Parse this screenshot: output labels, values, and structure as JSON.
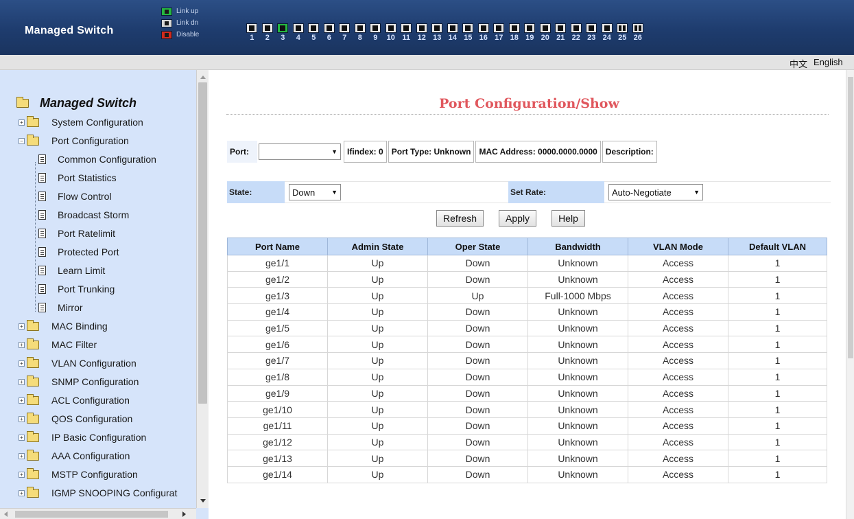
{
  "header": {
    "brand": "Managed Switch",
    "legend": {
      "link_up": "Link up",
      "link_dn": "Link dn",
      "disable": "Disable"
    },
    "ports": [
      {
        "num": "1",
        "state": "down"
      },
      {
        "num": "2",
        "state": "down"
      },
      {
        "num": "3",
        "state": "up"
      },
      {
        "num": "4",
        "state": "down"
      },
      {
        "num": "5",
        "state": "down"
      },
      {
        "num": "6",
        "state": "down"
      },
      {
        "num": "7",
        "state": "down"
      },
      {
        "num": "8",
        "state": "down"
      },
      {
        "num": "9",
        "state": "down"
      },
      {
        "num": "10",
        "state": "down"
      },
      {
        "num": "11",
        "state": "down"
      },
      {
        "num": "12",
        "state": "down"
      },
      {
        "num": "13",
        "state": "down"
      },
      {
        "num": "14",
        "state": "down"
      },
      {
        "num": "15",
        "state": "down"
      },
      {
        "num": "16",
        "state": "down"
      },
      {
        "num": "17",
        "state": "down"
      },
      {
        "num": "18",
        "state": "down"
      },
      {
        "num": "19",
        "state": "down"
      },
      {
        "num": "20",
        "state": "down"
      },
      {
        "num": "21",
        "state": "down"
      },
      {
        "num": "22",
        "state": "down"
      },
      {
        "num": "23",
        "state": "down"
      },
      {
        "num": "24",
        "state": "down"
      },
      {
        "num": "25",
        "state": "sfp"
      },
      {
        "num": "26",
        "state": "sfp"
      }
    ]
  },
  "langbar": {
    "zh": "中文",
    "en": "English"
  },
  "sidebar": {
    "root": "Managed Switch",
    "items": [
      {
        "label": "System Configuration",
        "type": "folder",
        "expander": "+"
      },
      {
        "label": "Port Configuration",
        "type": "folder-open",
        "expander": "-"
      },
      {
        "label": "Common Configuration",
        "type": "doc"
      },
      {
        "label": "Port Statistics",
        "type": "doc"
      },
      {
        "label": "Flow Control",
        "type": "doc"
      },
      {
        "label": "Broadcast Storm",
        "type": "doc"
      },
      {
        "label": "Port Ratelimit",
        "type": "doc"
      },
      {
        "label": "Protected Port",
        "type": "doc"
      },
      {
        "label": "Learn Limit",
        "type": "doc"
      },
      {
        "label": "Port Trunking",
        "type": "doc"
      },
      {
        "label": "Mirror",
        "type": "doc"
      },
      {
        "label": "MAC Binding",
        "type": "folder",
        "expander": "+"
      },
      {
        "label": "MAC Filter",
        "type": "folder",
        "expander": "+"
      },
      {
        "label": "VLAN Configuration",
        "type": "folder",
        "expander": "+"
      },
      {
        "label": "SNMP Configuration",
        "type": "folder",
        "expander": "+"
      },
      {
        "label": "ACL Configuration",
        "type": "folder",
        "expander": "+"
      },
      {
        "label": "QOS Configuration",
        "type": "folder",
        "expander": "+"
      },
      {
        "label": "IP Basic Configuration",
        "type": "folder",
        "expander": "+"
      },
      {
        "label": "AAA Configuration",
        "type": "folder",
        "expander": "+"
      },
      {
        "label": "MSTP Configuration",
        "type": "folder",
        "expander": "+"
      },
      {
        "label": "IGMP SNOOPING Configurat",
        "type": "folder",
        "expander": "+"
      }
    ]
  },
  "main": {
    "title": "Port Configuration/Show",
    "info": {
      "port_label": "Port:",
      "port_value": "",
      "ifindex": "Ifindex: 0",
      "port_type": "Port Type: Unknown",
      "mac": "MAC Address: 0000.0000.0000",
      "description": "Description:"
    },
    "state": {
      "label": "State:",
      "value": "Down",
      "rate_label": "Set Rate:",
      "rate_value": "Auto-Negotiate"
    },
    "buttons": {
      "refresh": "Refresh",
      "apply": "Apply",
      "help": "Help"
    },
    "table": {
      "headers": [
        "Port Name",
        "Admin State",
        "Oper State",
        "Bandwidth",
        "VLAN Mode",
        "Default VLAN"
      ],
      "rows": [
        [
          "ge1/1",
          "Up",
          "Down",
          "Unknown",
          "Access",
          "1"
        ],
        [
          "ge1/2",
          "Up",
          "Down",
          "Unknown",
          "Access",
          "1"
        ],
        [
          "ge1/3",
          "Up",
          "Up",
          "Full-1000 Mbps",
          "Access",
          "1"
        ],
        [
          "ge1/4",
          "Up",
          "Down",
          "Unknown",
          "Access",
          "1"
        ],
        [
          "ge1/5",
          "Up",
          "Down",
          "Unknown",
          "Access",
          "1"
        ],
        [
          "ge1/6",
          "Up",
          "Down",
          "Unknown",
          "Access",
          "1"
        ],
        [
          "ge1/7",
          "Up",
          "Down",
          "Unknown",
          "Access",
          "1"
        ],
        [
          "ge1/8",
          "Up",
          "Down",
          "Unknown",
          "Access",
          "1"
        ],
        [
          "ge1/9",
          "Up",
          "Down",
          "Unknown",
          "Access",
          "1"
        ],
        [
          "ge1/10",
          "Up",
          "Down",
          "Unknown",
          "Access",
          "1"
        ],
        [
          "ge1/11",
          "Up",
          "Down",
          "Unknown",
          "Access",
          "1"
        ],
        [
          "ge1/12",
          "Up",
          "Down",
          "Unknown",
          "Access",
          "1"
        ],
        [
          "ge1/13",
          "Up",
          "Down",
          "Unknown",
          "Access",
          "1"
        ],
        [
          "ge1/14",
          "Up",
          "Down",
          "Unknown",
          "Access",
          "1"
        ]
      ]
    }
  }
}
